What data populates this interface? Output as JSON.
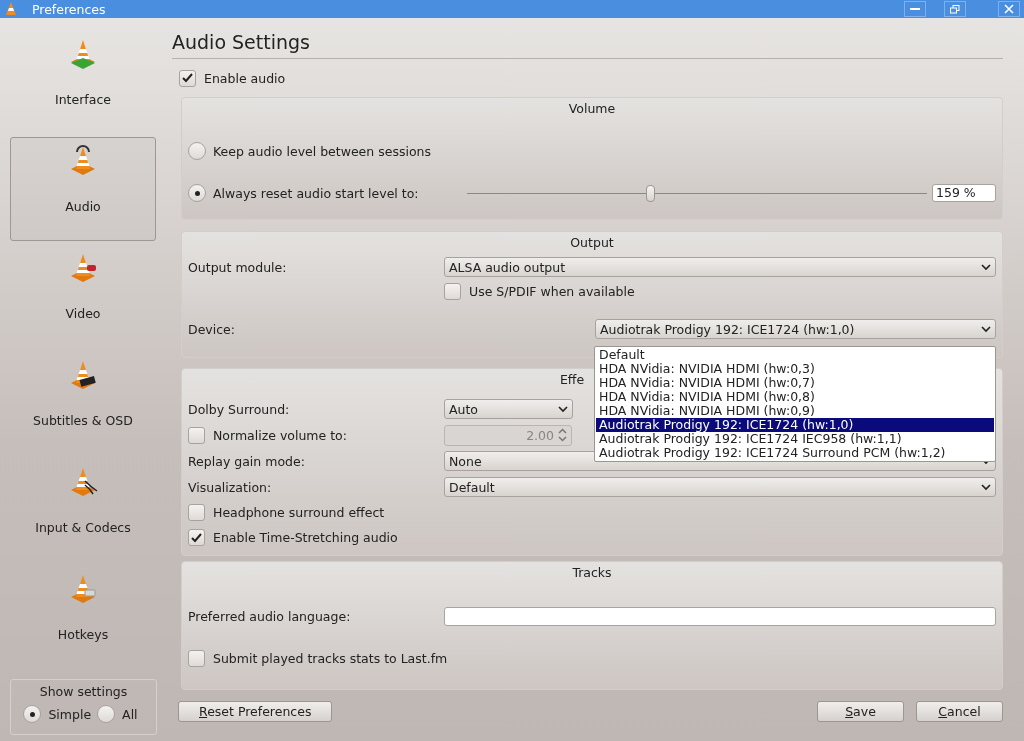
{
  "window": {
    "title": "Preferences"
  },
  "sidebar": {
    "items": [
      {
        "label": "Interface",
        "selected": false
      },
      {
        "label": "Audio",
        "selected": true
      },
      {
        "label": "Video",
        "selected": false
      },
      {
        "label": "Subtitles & OSD",
        "selected": false
      },
      {
        "label": "Input & Codecs",
        "selected": false
      },
      {
        "label": "Hotkeys",
        "selected": false
      }
    ]
  },
  "show_settings": {
    "title": "Show settings",
    "options": [
      {
        "label": "Simple",
        "selected": true
      },
      {
        "label": "All",
        "selected": false
      }
    ]
  },
  "heading": "Audio Settings",
  "enable_audio": {
    "label": "Enable audio",
    "checked": true
  },
  "volume": {
    "title": "Volume",
    "options": [
      {
        "label": "Keep audio level between sessions",
        "selected": false
      },
      {
        "label": "Always reset audio start level to:",
        "selected": true
      }
    ],
    "level": 0.4,
    "reading": "159 %"
  },
  "output": {
    "title": "Output",
    "module_label": "Output module:",
    "module_value": "ALSA audio output",
    "spdif": {
      "label": "Use S/PDIF when available",
      "checked": false
    },
    "device_label": "Device:",
    "device_value": "Audiotrak Prodigy 192: ICE1724 (hw:1,0)",
    "device_options": [
      {
        "label": "Default",
        "selected": false
      },
      {
        "label": "HDA NVidia: NVIDIA HDMI (hw:0,3)",
        "selected": false
      },
      {
        "label": "HDA NVidia: NVIDIA HDMI (hw:0,7)",
        "selected": false
      },
      {
        "label": "HDA NVidia: NVIDIA HDMI (hw:0,8)",
        "selected": false
      },
      {
        "label": "HDA NVidia: NVIDIA HDMI (hw:0,9)",
        "selected": false
      },
      {
        "label": "Audiotrak Prodigy 192: ICE1724 (hw:1,0)",
        "selected": true
      },
      {
        "label": "Audiotrak Prodigy 192: ICE1724 IEC958 (hw:1,1)",
        "selected": false
      },
      {
        "label": "Audiotrak Prodigy 192: ICE1724 Surround PCM (hw:1,2)",
        "selected": false
      }
    ]
  },
  "effects": {
    "title": "Effe",
    "rows": [
      {
        "kind": "select",
        "label": "Dolby Surround:",
        "value": "Auto"
      },
      {
        "kind": "spin",
        "label": "Normalize volume to:",
        "checked": false,
        "value": "2.00",
        "disabled": true
      },
      {
        "kind": "select",
        "label": "Replay gain mode:",
        "value": "None"
      },
      {
        "kind": "select",
        "label": "Visualization:",
        "value": "Default"
      },
      {
        "kind": "check",
        "label": "Headphone surround effect",
        "checked": false
      },
      {
        "kind": "check",
        "label": "Enable Time-Stretching audio",
        "checked": true
      }
    ]
  },
  "tracks": {
    "title": "Tracks",
    "language_label": "Preferred audio language:",
    "lastfm": {
      "label": "Submit played tracks stats to Last.fm",
      "checked": false
    }
  },
  "buttons": [
    {
      "label": "Reset Preferences",
      "kind": "left"
    },
    {
      "label": "Save",
      "kind": "right"
    },
    {
      "label": "Cancel",
      "kind": "right"
    }
  ]
}
